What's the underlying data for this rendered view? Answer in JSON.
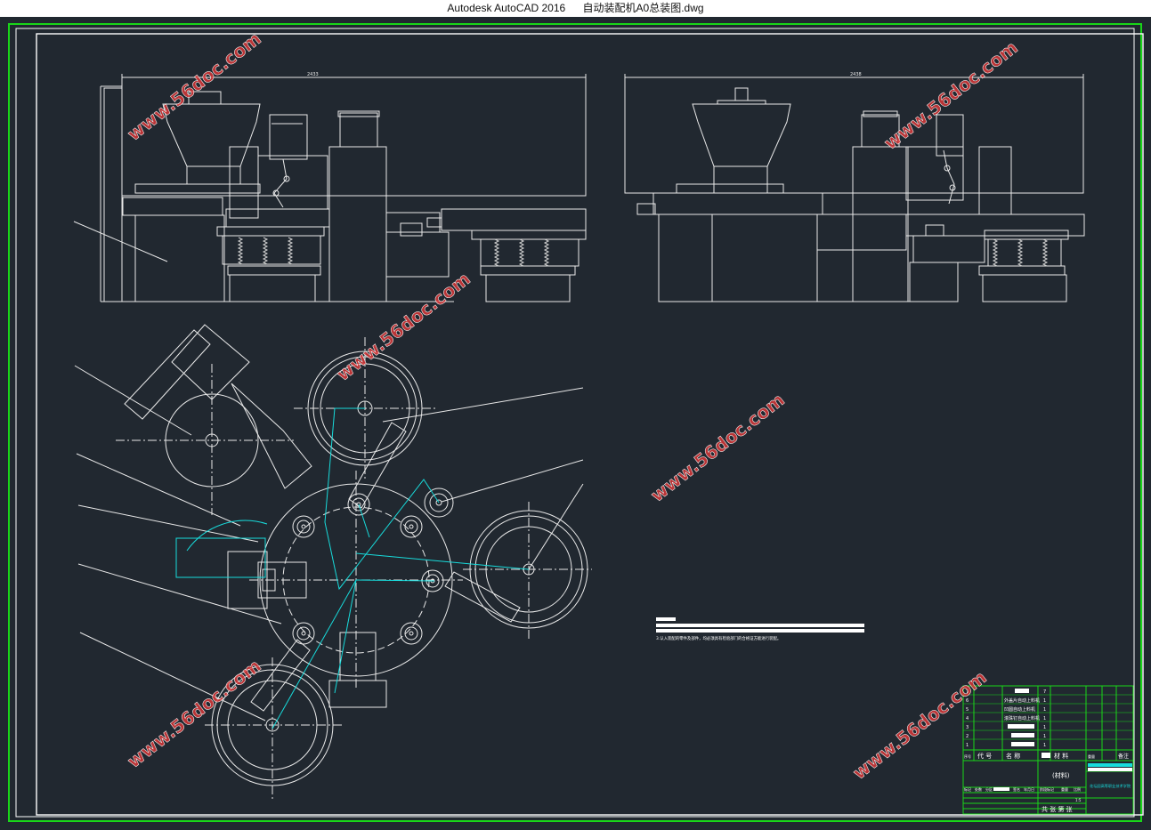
{
  "titlebar": {
    "app_name": "Autodesk AutoCAD 2016",
    "file_name": "自动装配机A0总装图.dwg"
  },
  "watermark": "www.56doc.com",
  "drawing": {
    "dim_front_width": "2433",
    "dim_side_width": "2438",
    "tech_note_line": "3.认入装配的零件及部件，均必须具有检验部门的合格证方能进行装配。",
    "material_label": "(材料)",
    "company_label": "花坛园高等职业技术学院",
    "count_label": "共 张  第 张",
    "title_header": {
      "seq": "序号",
      "code": "代 号",
      "name": "名 称",
      "qty": "数量",
      "material": "材 料",
      "weight": "重量",
      "note": "备注"
    },
    "parts": [
      {
        "seq": "7",
        "name": ""
      },
      {
        "seq": "6",
        "name": "外盖片自动上料机"
      },
      {
        "seq": "5",
        "name": "凹圆自动上料机"
      },
      {
        "seq": "4",
        "name": "滚珠钉自动上料机"
      },
      {
        "seq": "3",
        "name": ""
      },
      {
        "seq": "2",
        "name": ""
      },
      {
        "seq": "1",
        "name": ""
      }
    ],
    "sign_rows": [
      "标记",
      "处数",
      "分区",
      "更改文件号",
      "签名",
      "年月日"
    ],
    "stage_labels": [
      "阶段标记",
      "重量",
      "比例"
    ],
    "scale_value": "1:5"
  }
}
